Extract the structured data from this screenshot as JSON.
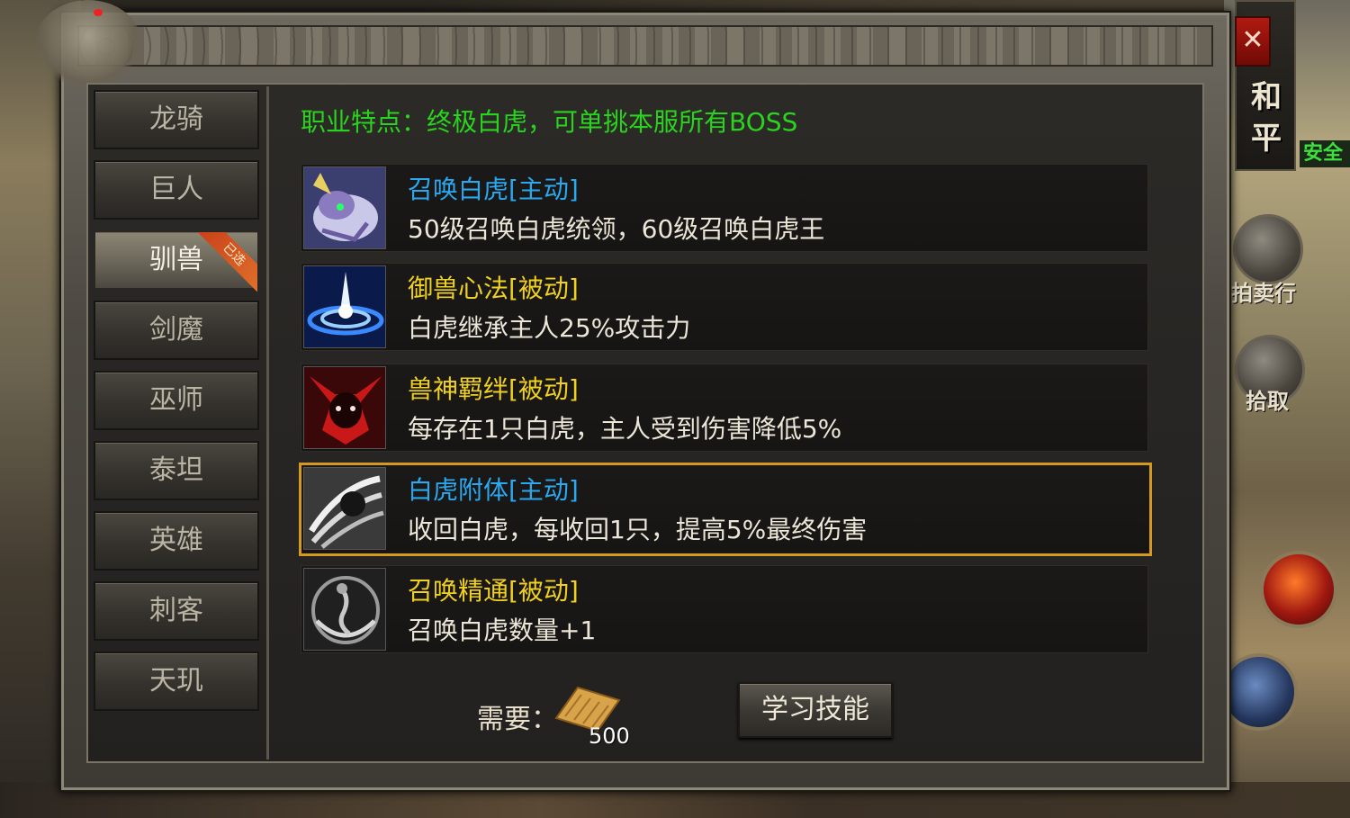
{
  "window": {
    "close_label": "✕"
  },
  "class_tabs": [
    {
      "label": "龙骑",
      "active": false
    },
    {
      "label": "巨人",
      "active": false
    },
    {
      "label": "驯兽",
      "active": true,
      "badge": "已选"
    },
    {
      "label": "剑魔",
      "active": false
    },
    {
      "label": "巫师",
      "active": false
    },
    {
      "label": "泰坦",
      "active": false
    },
    {
      "label": "英雄",
      "active": false
    },
    {
      "label": "刺客",
      "active": false
    },
    {
      "label": "天玑",
      "active": false
    }
  ],
  "trait_text": "职业特点：终极白虎，可单挑本服所有BOSS",
  "skills": [
    {
      "title": "召唤白虎[主动]",
      "type": "active",
      "description": "50级召唤白虎统领，60级召唤白虎王",
      "icon": "white-tiger-icon",
      "selected": false
    },
    {
      "title": "御兽心法[被动]",
      "type": "passive",
      "description": "白虎继承主人25%攻击力",
      "icon": "blue-vortex-icon",
      "selected": false
    },
    {
      "title": "兽神羁绊[被动]",
      "type": "passive",
      "description": "每存在1只白虎，主人受到伤害降低5%",
      "icon": "red-demon-icon",
      "selected": false
    },
    {
      "title": "白虎附体[主动]",
      "type": "active",
      "description": "收回白虎，每收回1只，提高5%最终伤害",
      "icon": "claw-slash-icon",
      "selected": true
    },
    {
      "title": "召唤精通[被动]",
      "type": "passive",
      "description": "召唤白虎数量+1",
      "icon": "summon-spirit-icon",
      "selected": false
    }
  ],
  "requirement": {
    "label": "需要：",
    "item_icon": "skill-book-scroll-icon",
    "count": "500"
  },
  "learn_button_label": "学习技能",
  "hud": {
    "peace_mode": [
      "和",
      "平"
    ],
    "safe_zone": "安全",
    "auction_label": "拍卖行",
    "pickup_label": "拾取"
  },
  "colors": {
    "active_skill": "#2aa8f0",
    "passive_skill": "#f0d020",
    "trait": "#2ad41e",
    "selected_border": "#d39a1e"
  }
}
